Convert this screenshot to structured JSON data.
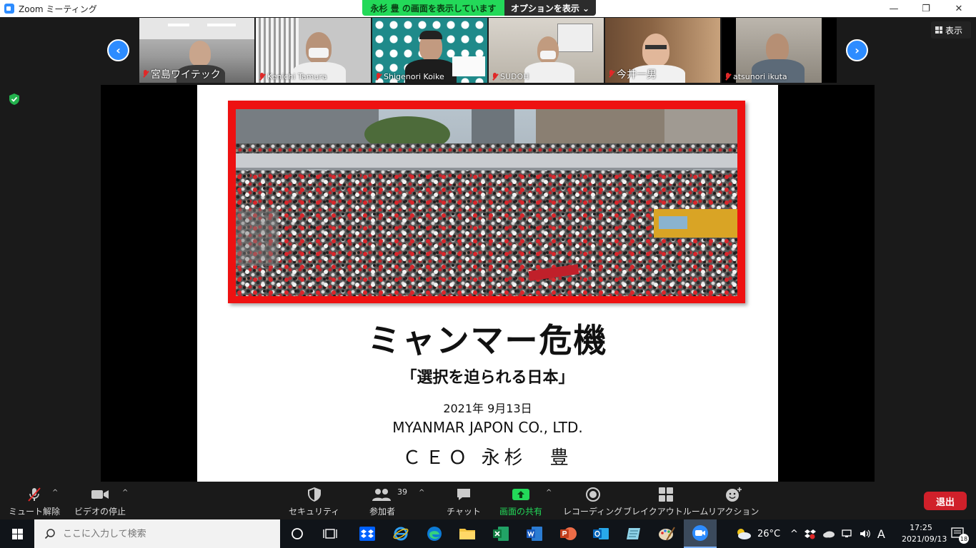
{
  "window": {
    "title": "Zoom ミーティング",
    "minimize_glyph": "—",
    "maximize_glyph": "❐",
    "close_glyph": "✕"
  },
  "share_banner": {
    "sharing_text": "永杉 豊 の画面を表示しています",
    "options_label": "オプションを表示 ⌄"
  },
  "gallery": {
    "prev_glyph": "‹",
    "next_glyph": "›",
    "view_label": "表示",
    "participants": [
      {
        "name": "宮島ワイテック"
      },
      {
        "name": "Kenichi Tamura"
      },
      {
        "name": "Shigenori Koike"
      },
      {
        "name": "SUDOH"
      },
      {
        "name": "今井一男"
      },
      {
        "name": "atsunori ikuta"
      }
    ]
  },
  "slide": {
    "title": "ミャンマー危機",
    "subtitle": "「選択を迫られる日本」",
    "date": "2021年 9月13日",
    "company": "MYANMAR JAPON CO., LTD.",
    "ceo": "ＣＥＯ 永杉　豊"
  },
  "toolbar": {
    "mute_label": "ミュート解除",
    "video_label": "ビデオの停止",
    "security_label": "セキュリティ",
    "participants_label": "参加者",
    "participants_count": "39",
    "chat_label": "チャット",
    "share_label": "画面の共有",
    "record_label": "レコーディング",
    "breakout_label": "ブレイクアウトルーム",
    "reaction_label": "リアクション",
    "end_label": "退出",
    "caret_glyph": "^"
  },
  "taskbar": {
    "search_placeholder": "ここに入力して検索",
    "weather": "26°C",
    "ime_indicator": "A",
    "time": "17:25",
    "date": "2021/09/13",
    "notification_count": "18"
  },
  "colors": {
    "zoom_blue": "#2d8cff",
    "share_green": "#23d959",
    "end_red": "#d0202a",
    "slide_frame_red": "#ee1111"
  }
}
